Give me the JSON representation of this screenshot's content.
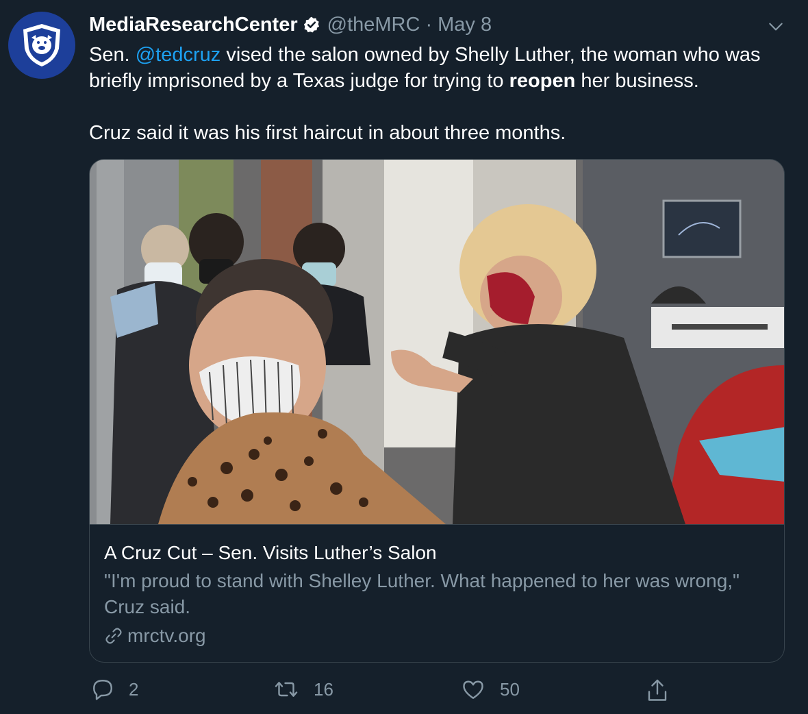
{
  "tweet": {
    "display_name": "MediaResearchCenter",
    "handle": "@theMRC",
    "separator": "·",
    "date": "May 8",
    "text_p1_a": "Sen. ",
    "text_p1_mention": "@tedcruz",
    "text_p1_b": " vised the salon owned by Shelly Luther, the woman who was briefly imprisoned by a Texas judge for trying to ",
    "text_p1_bold": "reopen",
    "text_p1_c": " her business.",
    "text_p2": "Cruz said it was his first haircut in about three months."
  },
  "card": {
    "title": "A Cruz Cut – Sen. Visits Luther’s Salon",
    "description": "\"I'm proud to stand with Shelley Luther. What happened to her was wrong,\" Cruz said.",
    "domain": "mrctv.org"
  },
  "actions": {
    "replies": "2",
    "retweets": "16",
    "likes": "50"
  },
  "icons": {
    "avatar": "bulldog-logo-icon",
    "verified": "verified-badge-icon",
    "menu": "chevron-down-icon",
    "link": "link-icon",
    "reply": "reply-icon",
    "retweet": "retweet-icon",
    "like": "heart-icon",
    "share": "share-icon"
  },
  "colors": {
    "background": "#15202b",
    "accent": "#1da1f2",
    "secondary_text": "#8899a6",
    "border": "#38444d",
    "avatar_bg": "#1d3f9a"
  }
}
